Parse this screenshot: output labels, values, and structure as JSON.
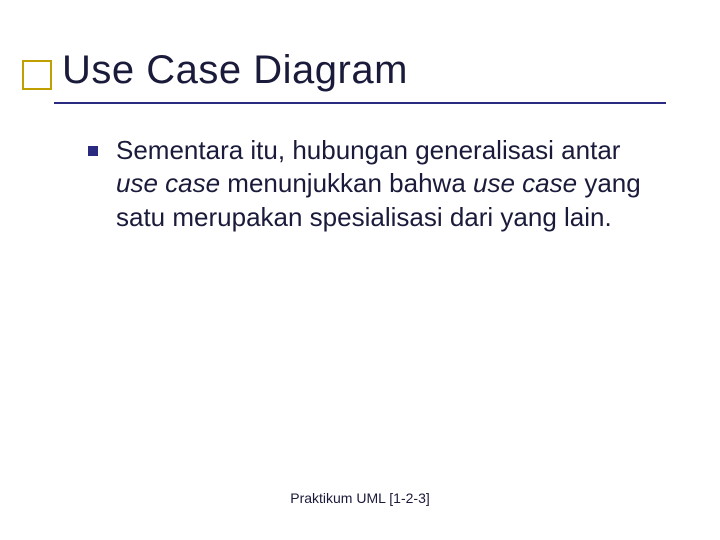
{
  "slide": {
    "title": "Use Case Diagram",
    "bullet": {
      "seg1": "Sementara itu, hubungan generalisasi antar ",
      "seg2_italic": "use case",
      "seg3": " menunjukkan bahwa ",
      "seg4_italic": "use case",
      "seg5": " yang satu merupakan spesialisasi dari yang lain."
    },
    "footer": "Praktikum UML [1-2-3]"
  }
}
